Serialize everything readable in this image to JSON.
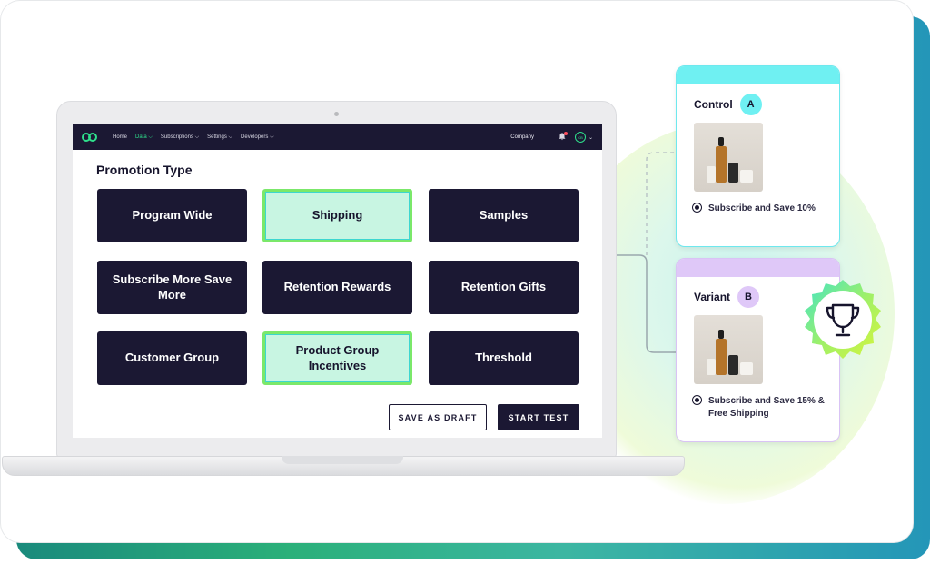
{
  "nav": {
    "items": [
      {
        "label": "Home",
        "active": false
      },
      {
        "label": "Data ⌵",
        "active": true
      },
      {
        "label": "Subscriptions ⌵",
        "active": false
      },
      {
        "label": "Settings ⌵",
        "active": false
      },
      {
        "label": "Developers ⌵",
        "active": false
      }
    ],
    "company": "Company",
    "avatar_initials": "CB",
    "icons": {
      "logo": "infinity-logo-icon",
      "bell": "bell-icon",
      "chevron": "chevron-down-icon"
    }
  },
  "promotion": {
    "title": "Promotion Type",
    "tiles": [
      {
        "label": "Program Wide",
        "selected": false
      },
      {
        "label": "Shipping",
        "selected": true
      },
      {
        "label": "Samples",
        "selected": false
      },
      {
        "label": "Subscribe More Save More",
        "selected": false
      },
      {
        "label": "Retention Rewards",
        "selected": false
      },
      {
        "label": "Retention Gifts",
        "selected": false
      },
      {
        "label": "Customer Group",
        "selected": false
      },
      {
        "label": "Product Group Incentives",
        "selected": true
      },
      {
        "label": "Threshold",
        "selected": false
      }
    ],
    "save_draft_label": "SAVE AS DRAFT",
    "start_test_label": "START TEST"
  },
  "control": {
    "label": "Control",
    "badge": "A",
    "offer": "Subscribe and Save 10%",
    "color": "#6ff0f2"
  },
  "variant": {
    "label": "Variant",
    "badge": "B",
    "offer": "Subscribe and Save 15% & Free Shipping",
    "color": "#dfc8f8"
  },
  "winner_icon": "trophy-icon",
  "colors": {
    "navy": "#1b1833",
    "accent_green": "#2fe08c",
    "selected_tile": "#c8f5e2"
  }
}
